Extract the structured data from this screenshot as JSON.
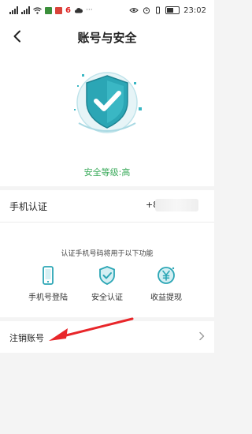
{
  "status_bar": {
    "time": "23:02",
    "notification_count": "6"
  },
  "header": {
    "title": "账号与安全"
  },
  "hero": {
    "security_level": "安全等级:高"
  },
  "phone": {
    "label": "手机认证",
    "value_prefix": "+8"
  },
  "features": {
    "note": "认证手机号码将用于以下功能",
    "items": [
      {
        "label": "手机号登陆",
        "icon": "phone-icon"
      },
      {
        "label": "安全认证",
        "icon": "shield-check-icon"
      },
      {
        "label": "收益提现",
        "icon": "yuan-coin-icon"
      }
    ]
  },
  "account": {
    "cancel_label": "注销账号"
  },
  "colors": {
    "accent": "#2ba6b5",
    "success": "#3cab5c",
    "annotation": "#e8262a"
  }
}
